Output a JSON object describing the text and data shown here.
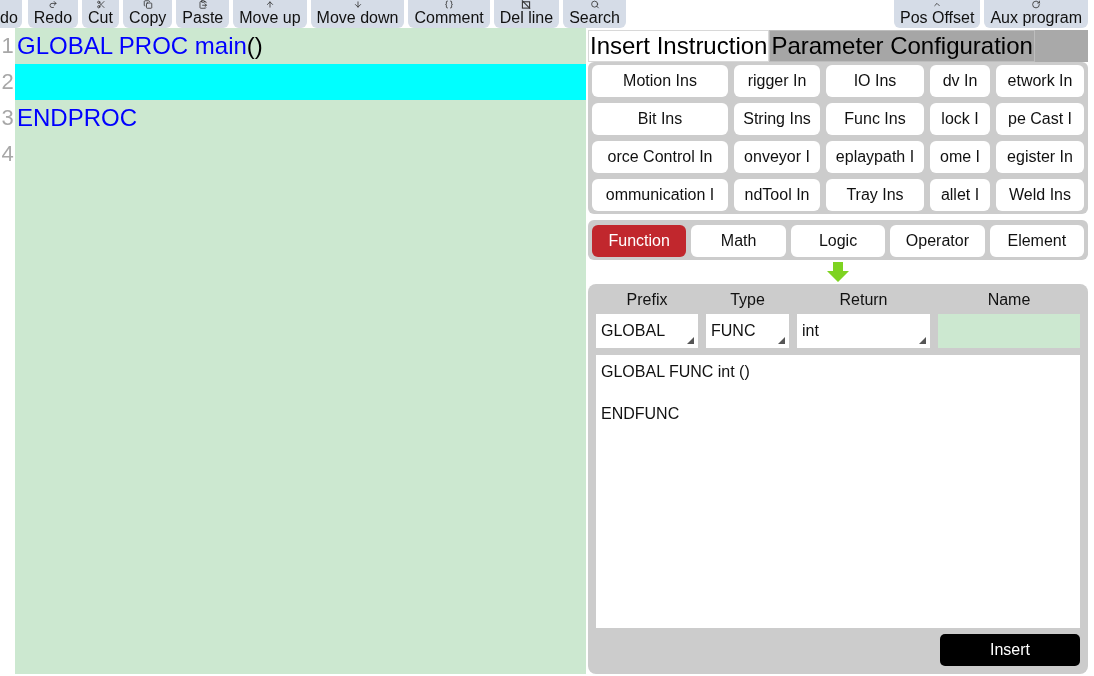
{
  "toolbar": {
    "left_buttons": [
      "do",
      "Redo",
      "Cut",
      "Copy",
      "Paste",
      "Move up",
      "Move down",
      "Comment",
      "Del line",
      "Search"
    ],
    "right_buttons": [
      "Pos Offset",
      "Aux program"
    ]
  },
  "editor": {
    "lines": [
      {
        "number": "1",
        "selected": false,
        "tokens": [
          {
            "text": "GLOBAL PROC main",
            "kind": "keyword"
          },
          {
            "text": "()",
            "kind": "plain"
          }
        ]
      },
      {
        "number": "2",
        "selected": true
      },
      {
        "number": "3",
        "selected": false,
        "tokens": [
          {
            "text": "ENDPROC",
            "kind": "keyword"
          }
        ]
      },
      {
        "number": "4",
        "selected": false
      }
    ]
  },
  "panel": {
    "tabs": [
      {
        "label": "Insert Instruction",
        "selected": true
      },
      {
        "label": "Parameter Configuration",
        "selected": false
      }
    ],
    "instruction_buttons": [
      "Motion Ins",
      "rigger In",
      "IO Ins",
      "dv In",
      "etwork In",
      "Bit Ins",
      "String Ins",
      "Func Ins",
      "lock I",
      "pe Cast I",
      "orce Control In",
      "onveyor I",
      "eplaypath I",
      "ome I",
      "egister In",
      "ommunication I",
      "ndTool In",
      "Tray Ins",
      "allet I",
      "Weld Ins"
    ],
    "categories": [
      {
        "label": "Function",
        "selected": true
      },
      {
        "label": "Math",
        "selected": false
      },
      {
        "label": "Logic",
        "selected": false
      },
      {
        "label": "Operator",
        "selected": false
      },
      {
        "label": "Element",
        "selected": false
      }
    ],
    "form": {
      "fields": [
        {
          "label": "Prefix",
          "kind": "select",
          "value": "GLOBAL"
        },
        {
          "label": "Type",
          "kind": "select",
          "value": "FUNC"
        },
        {
          "label": "Return",
          "kind": "select",
          "value": "int"
        },
        {
          "label": "Name",
          "kind": "input"
        }
      ],
      "preview": "GLOBAL FUNC int ()\n\nENDFUNC",
      "insert_button": "Insert"
    }
  }
}
